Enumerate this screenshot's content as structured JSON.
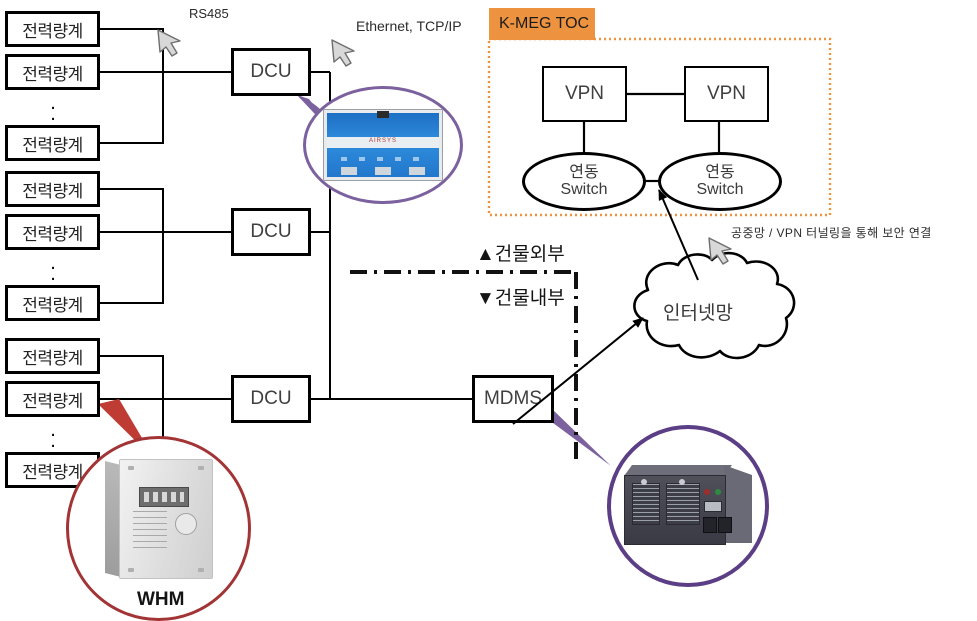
{
  "diagram": {
    "title_tag": "K-MEG TOC",
    "colors": {
      "accent_orange": "#ED9340",
      "purple": "#7B619E",
      "red_circle": "#A33436",
      "line_black": "#000000",
      "text_gray": "#3a3a3a"
    }
  },
  "meters": {
    "label": "전력량계",
    "groups": [
      {
        "items": [
          "전력량계",
          "전력량계",
          "전력량계"
        ],
        "ellipsis": "."
      },
      {
        "items": [
          "전력량계",
          "전력량계",
          "전력량계"
        ],
        "ellipsis": "."
      },
      {
        "items": [
          "전력량계",
          "전력량계",
          "전력량계"
        ],
        "ellipsis": "."
      }
    ]
  },
  "concentrators": {
    "label": "DCU",
    "items": [
      "DCU",
      "DCU",
      "DCU"
    ]
  },
  "server": {
    "mdms_label": "MDMS"
  },
  "toc": {
    "tag_label": "K-MEG TOC",
    "vpn_left": "VPN",
    "vpn_right": "VPN",
    "switch_left_line1": "연동",
    "switch_left_line2": "Switch",
    "switch_right_line1": "연동",
    "switch_right_line2": "Switch"
  },
  "cloud": {
    "label": "인터넷망"
  },
  "annotations": {
    "rs485": "RS485",
    "ethernet": "Ethernet, TCP/IP",
    "tunneling": "공중망 / VPN 터널링을 통해 보안 연결",
    "building_outside": "▲건물외부",
    "building_inside": "▼건물내부"
  },
  "callouts": {
    "whm_label": "WHM",
    "dcu_photo_name": "dcu-device-photo",
    "server_photo_name": "mdms-server-photo",
    "whm_photo_name": "whm-meter-photo"
  }
}
